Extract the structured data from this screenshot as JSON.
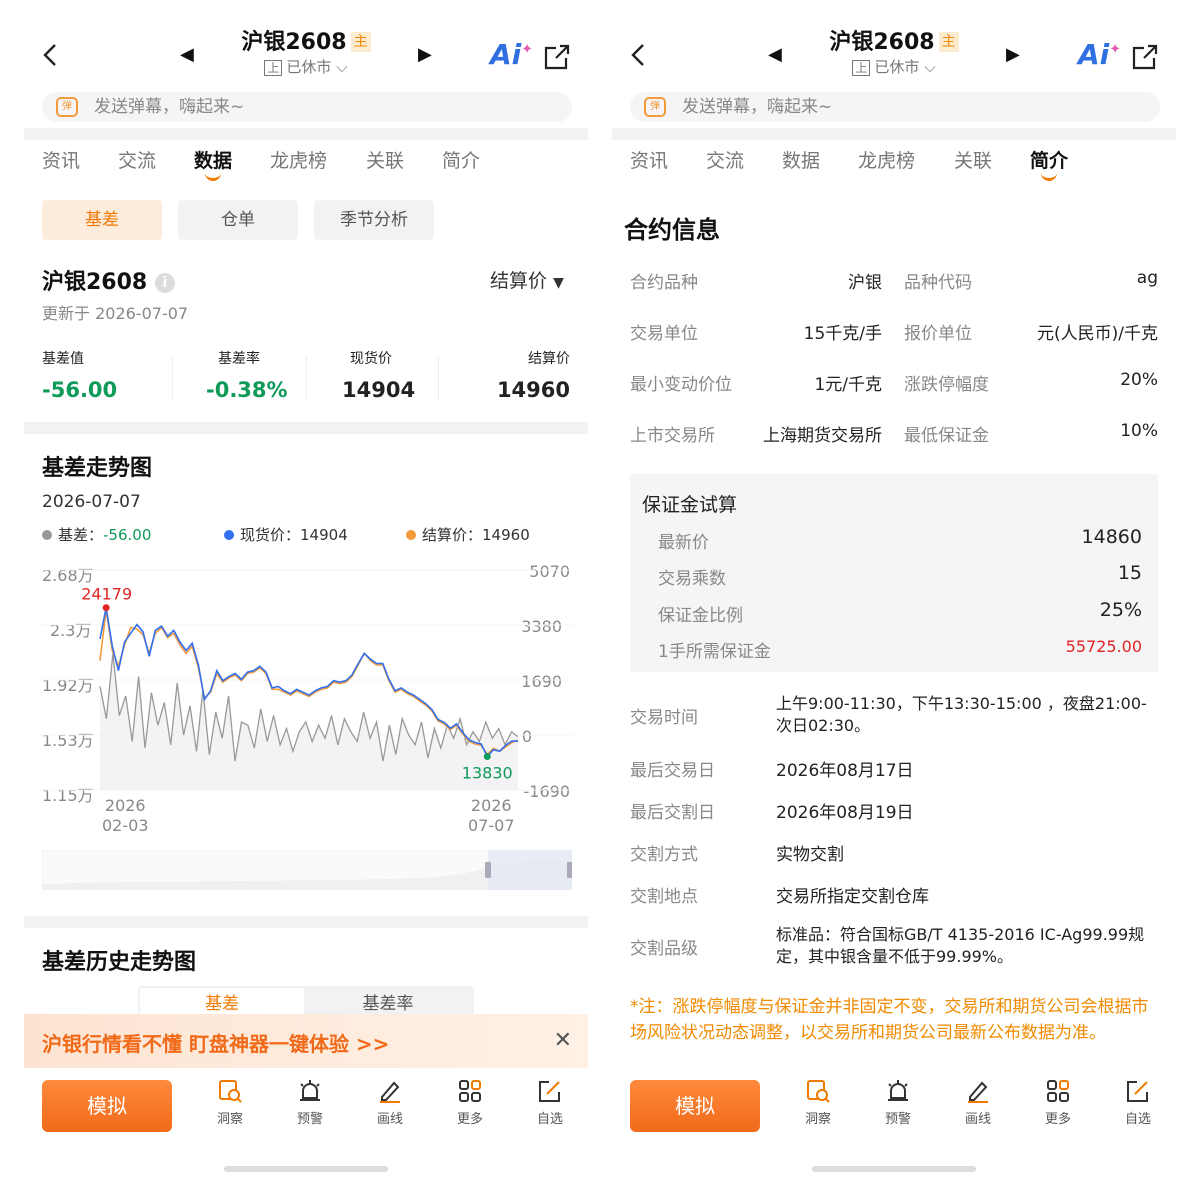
{
  "header": {
    "title": "沪银2608",
    "main_tag": "主",
    "exchange_badge": "上",
    "status": "已休市",
    "ai_label": "Ai",
    "danmu_placeholder": "发送弹幕，嗨起来~"
  },
  "tabs": [
    "资讯",
    "交流",
    "数据",
    "龙虎榜",
    "关联",
    "简介"
  ],
  "left": {
    "active_tab": "数据",
    "segments": [
      "基差",
      "仓单",
      "季节分析"
    ],
    "contract_name": "沪银2608",
    "updated": "更新于 2026-07-07",
    "price_selector": "结算价",
    "stats": [
      {
        "label": "基差值",
        "value": "-56.00"
      },
      {
        "label": "基差率",
        "value": "-0.38%"
      },
      {
        "label": "现货价",
        "value": "14904"
      },
      {
        "label": "结算价",
        "value": "14960"
      }
    ],
    "chart_title": "基差走势图",
    "chart_date": "2026-07-07",
    "legend": [
      {
        "label": "基差：",
        "value": "-56.00",
        "color": "#999999"
      },
      {
        "label": "现货价：",
        "value": "14904",
        "color": "#3370f0"
      },
      {
        "label": "结算价：",
        "value": "14960",
        "color": "#f29a3c"
      }
    ],
    "history_title": "基差历史走势图",
    "history_segments": [
      "基差",
      "基差率"
    ],
    "history_peek_date": "07-07",
    "banner_text": "沪银行情看不懂  盯盘神器一键体验 >>"
  },
  "chart_data": {
    "type": "line",
    "title": "基差走势图",
    "left_axis_ticks": [
      "2.68万",
      "2.3万",
      "1.92万",
      "1.53万",
      "1.15万"
    ],
    "right_axis_ticks": [
      "5070",
      "3380",
      "1690",
      "0",
      "-1690"
    ],
    "x_ticks": [
      [
        "2026",
        "02-03"
      ],
      [
        "2026",
        "07-07"
      ]
    ],
    "ylim_left": [
      11500,
      26800
    ],
    "ylim_right": [
      -1690,
      5070
    ],
    "annotations": [
      {
        "text": "24179",
        "series": "现货价",
        "type": "max"
      },
      {
        "text": "13830",
        "series": "现货价",
        "type": "min"
      }
    ],
    "series": [
      {
        "name": "现货价",
        "color": "#3370f0",
        "axis": "left",
        "values": [
          22000,
          24179,
          21500,
          19800,
          21800,
          22400,
          23000,
          22500,
          20800,
          22600,
          22900,
          22200,
          22600,
          21800,
          21200,
          21700,
          20200,
          17800,
          18400,
          19800,
          19100,
          19400,
          19600,
          19200,
          19700,
          19800,
          20100,
          19700,
          18600,
          18700,
          18400,
          18200,
          18500,
          18300,
          18100,
          18400,
          18600,
          18700,
          19100,
          19000,
          19100,
          19500,
          20300,
          21000,
          20600,
          20300,
          20300,
          19200,
          18400,
          18600,
          18300,
          18100,
          17800,
          17500,
          17100,
          16400,
          16200,
          15800,
          16100,
          15500,
          15000,
          14800,
          14700,
          13830,
          14300,
          14200,
          14600,
          14900,
          14904
        ]
      },
      {
        "name": "结算价",
        "color": "#f29a3c",
        "axis": "left",
        "values": [
          20500,
          24000,
          21200,
          20100,
          21600,
          22800,
          22700,
          22300,
          21000,
          22400,
          22800,
          22100,
          22400,
          21600,
          21000,
          21500,
          20000,
          17900,
          18300,
          19600,
          19000,
          19300,
          19500,
          19100,
          19600,
          19700,
          20000,
          19600,
          18500,
          18500,
          18300,
          18100,
          18400,
          18200,
          18000,
          18300,
          18500,
          18600,
          19000,
          18900,
          19000,
          19400,
          20200,
          21000,
          20500,
          20200,
          20200,
          19100,
          18300,
          18500,
          18200,
          18000,
          17700,
          17400,
          17000,
          16300,
          16100,
          15700,
          16000,
          15400,
          14900,
          14700,
          14600,
          14000,
          14400,
          14200,
          14500,
          14800,
          14960
        ]
      },
      {
        "name": "基差",
        "color": "#999999",
        "axis": "right",
        "values": [
          1500,
          500,
          2500,
          600,
          1200,
          -200,
          1800,
          -400,
          1300,
          300,
          1000,
          -300,
          1600,
          0,
          900,
          -500,
          1400,
          -600,
          700,
          -100,
          1200,
          -800,
          400,
          300,
          -400,
          800,
          -200,
          600,
          -300,
          200,
          -500,
          100,
          400,
          -200,
          300,
          -100,
          600,
          -300,
          500,
          100,
          -200,
          700,
          -100,
          400,
          -800,
          300,
          -600,
          500,
          0,
          -300,
          400,
          -700,
          200,
          -400,
          300,
          -100,
          500,
          -300,
          100,
          -200,
          400,
          -100,
          200,
          -300,
          100,
          -56
        ]
      }
    ]
  },
  "right": {
    "active_tab": "简介",
    "section_title": "合约信息",
    "grid": [
      {
        "k1": "合约品种",
        "v1": "沪银",
        "k2": "品种代码",
        "v2": "ag"
      },
      {
        "k1": "交易单位",
        "v1": "15千克/手",
        "k2": "报价单位",
        "v2": "元(人民币)/千克"
      },
      {
        "k1": "最小变动价位",
        "v1": "1元/千克",
        "k2": "涨跌停幅度",
        "v2": "20%"
      },
      {
        "k1": "上市交易所",
        "v1": "上海期货交易所",
        "k2": "最低保证金",
        "v2": "10%"
      }
    ],
    "margin_title": "保证金试算",
    "margin_rows": [
      {
        "k": "最新价",
        "v": "14860"
      },
      {
        "k": "交易乘数",
        "v": "15"
      },
      {
        "k": "保证金比例",
        "v": "25%"
      },
      {
        "k": "1手所需保证金",
        "v": "55725.00"
      }
    ],
    "details": [
      {
        "k": "交易时间",
        "v": "上午9:00-11:30，下午13:30-15:00 ，夜盘21:00-次日02:30。"
      },
      {
        "k": "最后交易日",
        "v": "2026年08月17日"
      },
      {
        "k": "最后交割日",
        "v": "2026年08月19日"
      },
      {
        "k": "交割方式",
        "v": "实物交割"
      },
      {
        "k": "交割地点",
        "v": "交易所指定交割仓库"
      },
      {
        "k": "交割品级",
        "v": "标准品：符合国标GB/T 4135-2016 IC-Ag99.99规定，其中银含量不低于99.99%。"
      }
    ],
    "note": "*注：涨跌停幅度与保证金并非固定不变，交易所和期货公司会根据市场风险状况动态调整，以交易所和期货公司最新公布数据为准。"
  },
  "bottom": {
    "mock_label": "模拟",
    "items": [
      "洞察",
      "预警",
      "画线",
      "更多",
      "自选"
    ]
  }
}
